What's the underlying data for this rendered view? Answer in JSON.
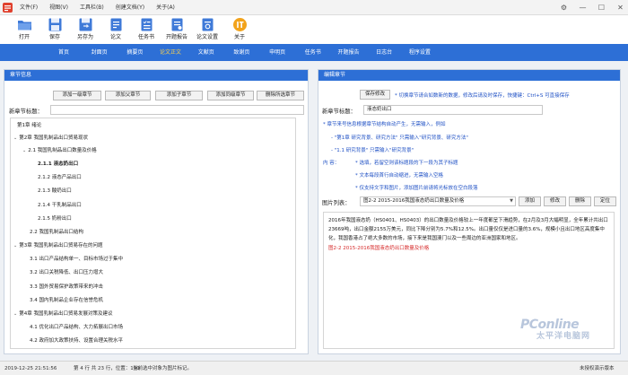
{
  "titlebar": {
    "menu": [
      "文件(F)",
      "视图(V)",
      "工具栏(B)",
      "创建文档(Y)",
      "关于(A)"
    ]
  },
  "toolbar": {
    "buttons": [
      "打开",
      "保存",
      "另存为",
      "论文",
      "任务书",
      "开题报告",
      "论文设置",
      "关于"
    ]
  },
  "nav": {
    "tabs": [
      "首页",
      "封面页",
      "摘要页",
      "论文正文",
      "文献页",
      "致谢页",
      "申明页",
      "任务书",
      "开题报告",
      "日志台",
      "程序设置"
    ],
    "active_index": 3
  },
  "left_panel": {
    "title": "章节信息",
    "buttons": [
      "添加一级章节",
      "添加父章节",
      "添加子章节",
      "添加同级章节",
      "删除所选章节"
    ],
    "new_title_label": "新章节标题：",
    "tree": [
      {
        "text": "第1章   绪论",
        "level": 0,
        "arrow": false
      },
      {
        "text": "第2章   我国乳制品出口贸易现状",
        "level": 0,
        "arrow": true
      },
      {
        "text": "2.1 我国乳制品出口数量及价格",
        "level": 1,
        "arrow": true
      },
      {
        "text": "2.1.1 液态奶出口",
        "level": 2,
        "arrow": false,
        "selected": true
      },
      {
        "text": "2.1.2 液态产品出口",
        "level": 2,
        "arrow": false
      },
      {
        "text": "2.1.3 酸奶出口",
        "level": 2,
        "arrow": false
      },
      {
        "text": "2.1.4 干乳制品出口",
        "level": 2,
        "arrow": false
      },
      {
        "text": "2.1.5 奶粉出口",
        "level": 2,
        "arrow": false
      },
      {
        "text": "2.2 我国乳制品出口结构",
        "level": 1,
        "arrow": false
      },
      {
        "text": "第3章   我国乳制品出口贸易存在的问题",
        "level": 0,
        "arrow": true
      },
      {
        "text": "3.1 出口产品结构单一、目标市场过于集中",
        "level": 1,
        "arrow": false
      },
      {
        "text": "3.2 出口关税降低、出口压力增大",
        "level": 1,
        "arrow": false
      },
      {
        "text": "3.3 国外贸易保护政策带来的冲击",
        "level": 1,
        "arrow": false
      },
      {
        "text": "3.4 国内乳制品企业存在信誉危机",
        "level": 1,
        "arrow": false
      },
      {
        "text": "第4章   我国乳制品出口贸易发展对策及建议",
        "level": 0,
        "arrow": true
      },
      {
        "text": "4.1 优化出口产品结构、大力拓展出口市场",
        "level": 1,
        "arrow": false
      },
      {
        "text": "4.2 政府加大政策扶持、设置合理关税水平",
        "level": 1,
        "arrow": false
      }
    ]
  },
  "right_panel": {
    "title": "编辑章节",
    "save_button": "保存修改",
    "save_hint": "* 切换章节请合如数新的数据，修改后请及时保存，快捷键：Ctrl+S 可直接保存",
    "new_title_label": "新章节标题：",
    "new_title_value": "液态奶出口",
    "chapter_hint": "* 章节来号信息根据章节结构自动产生，无需输入，例如",
    "example_1": "- \"第1章  研究背景、研究方法\" 只需输入\"研究背景、研究方法\"",
    "example_2": "- \"1.1 研究背景\" 只需输入\"研究背景\"",
    "content_label": "内   容：",
    "content_hints": [
      "* 选填，若留空则该标题段的下一段为其子标题",
      "* 文本每段首行自动缩进，无需输入空格",
      "* 仅支持文字和图片，添加图片前请将光标放在空白段落"
    ],
    "image_list_label": "图片列表：",
    "image_selected": "图2-2 2015-2016我国液态奶出口数量及价格",
    "image_buttons": [
      "添加",
      "修改",
      "删除",
      "定位"
    ],
    "editor_text": "2016年我国液态奶（HS0401、HS0403）的出口数量及价格较上一年度都呈下滑趋势，在2月及3月大幅明显，全年累计共出口23669吨，出口金额2155万美元，同比下降分别为5.7%和12.5%。出口量仅仅是进口量的3.6%，规模小且出口地区高度集中化，我国香港占了绝大多数的市场，接下来是我国澳门以及一些周边的亚洲国家和地区。",
    "editor_caption": "图2-2 2015-2016我国液态奶出口数量及价格"
  },
  "statusbar": {
    "datetime": "2019-12-25 21:51:56",
    "page_info": "第 4 行 共 23 行，位置：190",
    "message": "当前选中对象为图片标记。",
    "right": "未授权演示版本"
  },
  "watermark": {
    "brand": "PConline",
    "sub": "太平洋电脑网"
  },
  "colors": {
    "accent": "#2d6fd6",
    "nav_active": "#ffd24a",
    "hint": "#1d4fc4",
    "caption": "#d62a2a"
  },
  "icons": {
    "toolbar": [
      "folder-open-icon",
      "save-icon",
      "save-as-icon",
      "document-add-icon",
      "task-document-icon",
      "report-document-icon",
      "settings-document-icon",
      "about-logo-icon"
    ],
    "window": [
      "gear-icon",
      "minimize-icon",
      "maximize-icon",
      "close-icon"
    ]
  }
}
